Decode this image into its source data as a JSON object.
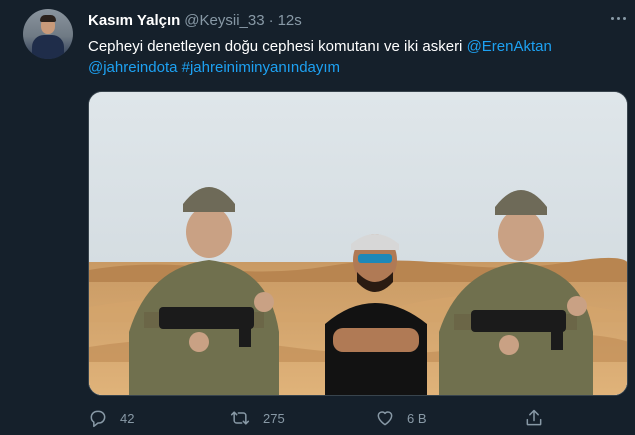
{
  "tweet": {
    "author_name": "Kasım Yalçın",
    "handle": "@Keysii_33",
    "separator": "·",
    "time": "12s",
    "text_plain_1": "Cepheyi denetleyen doğu cephesi komutanı ve iki askeri",
    "mention_1": "@ErenAktan",
    "mention_2": "@jahreindota",
    "hashtag": "#jahreiniminyanındayım"
  },
  "actions": {
    "reply_count": "42",
    "retweet_count": "275",
    "like_count": "6 B"
  },
  "icons": {
    "more": "more-dots-icon",
    "reply": "reply-icon",
    "retweet": "retweet-icon",
    "like": "heart-icon",
    "share": "share-icon"
  },
  "colors": {
    "background": "#15202b",
    "link": "#1da1f2",
    "muted": "#8899a6"
  }
}
